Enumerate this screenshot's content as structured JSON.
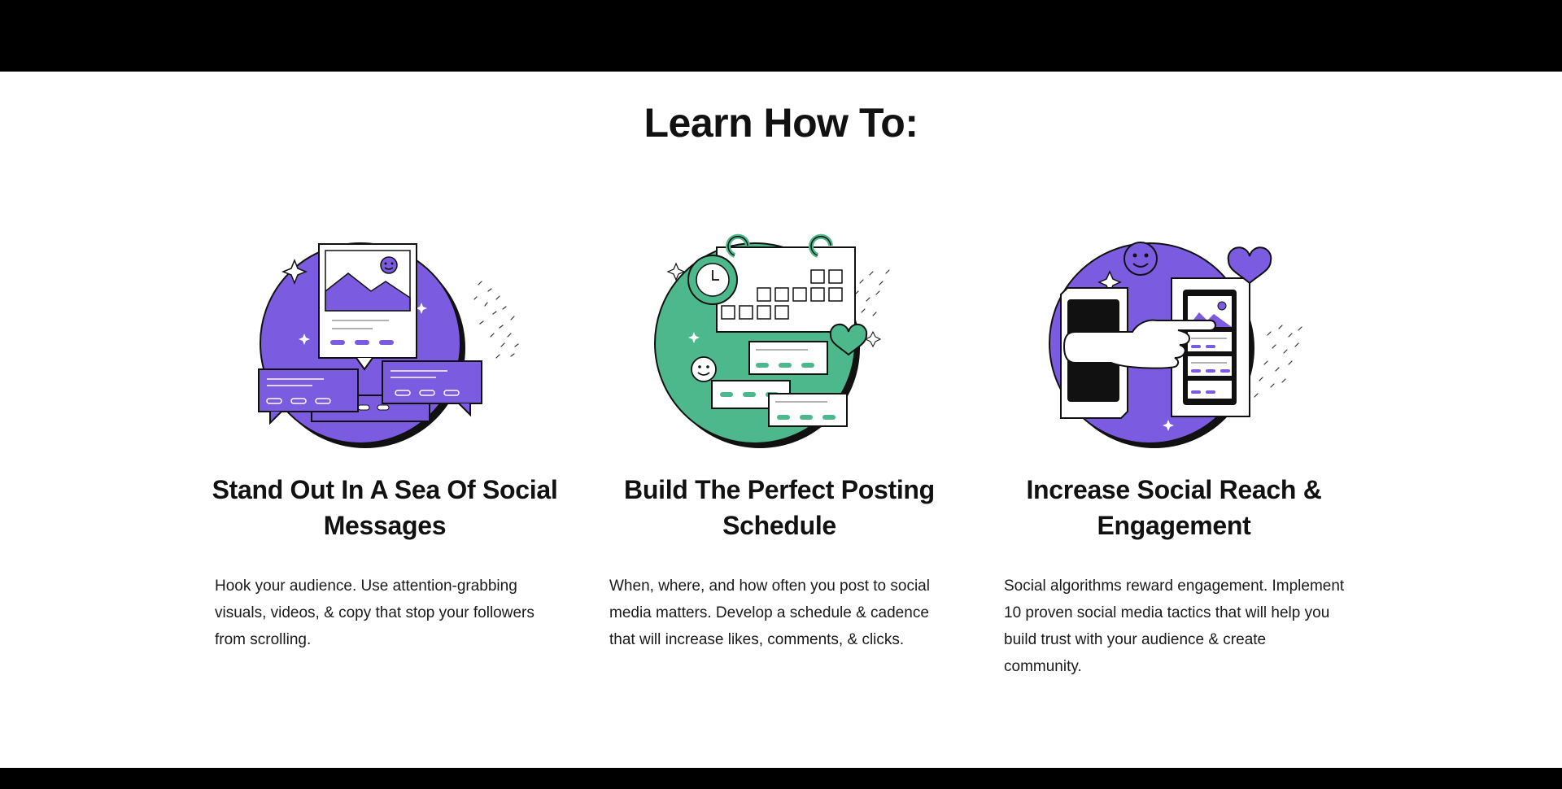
{
  "heading": "Learn How To:",
  "colors": {
    "purple": "#7b5ce1",
    "green": "#4cb88c",
    "ink": "#111111",
    "background": "#ffffff"
  },
  "features": [
    {
      "title": "Stand Out In A Sea Of Social Messages",
      "description": "Hook your audience. Use attention-grabbing visuals, videos, & copy that stop your followers from scrolling.",
      "illustration": "social-messages-illustration",
      "accent": "#7b5ce1"
    },
    {
      "title": "Build The Perfect Posting Schedule",
      "description": "When, where, and how often you post to social media matters. Develop a schedule & cadence that will increase likes, comments, & clicks.",
      "illustration": "posting-schedule-illustration",
      "accent": "#4cb88c"
    },
    {
      "title": "Increase Social Reach & Engagement",
      "description": "Social algorithms reward engagement. Implement 10 proven social media tactics that will help you build trust with your audience & create community.",
      "illustration": "social-reach-illustration",
      "accent": "#7b5ce1"
    }
  ]
}
